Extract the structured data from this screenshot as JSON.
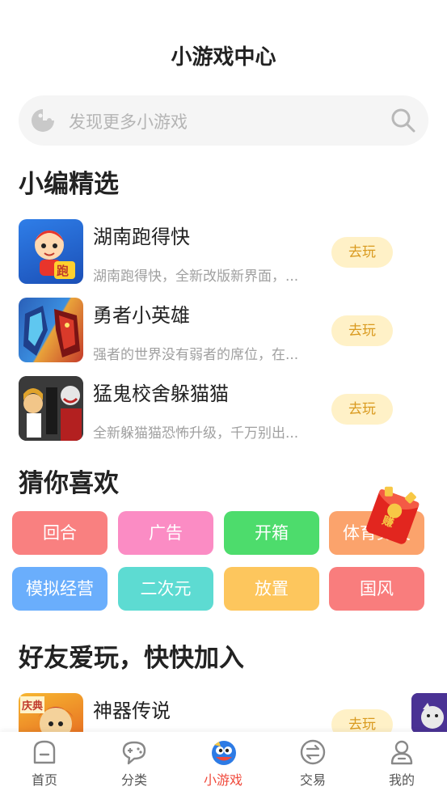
{
  "header": {
    "title": "小游戏中心"
  },
  "search": {
    "placeholder": "发现更多小游戏"
  },
  "editor_picks": {
    "title": "小编精选",
    "items": [
      {
        "name": "湖南跑得快",
        "desc": "湖南跑得快，全新改版新界面，...",
        "button": "去玩",
        "thumb_text": "跑"
      },
      {
        "name": "勇者小英雄",
        "desc": "强者的世界没有弱者的席位，在...",
        "button": "去玩"
      },
      {
        "name": "猛鬼校舍躲猫猫",
        "desc": "全新躲猫猫恐怖升级，千万别出...",
        "button": "去玩"
      }
    ]
  },
  "guess": {
    "title": "猜你喜欢",
    "tags": [
      {
        "label": "回合",
        "color": "#f98080"
      },
      {
        "label": "广告",
        "color": "#fb8cc4"
      },
      {
        "label": "开箱",
        "color": "#4ddc6c"
      },
      {
        "label": "体育竞技",
        "color": "#fba36c"
      },
      {
        "label": "模拟经营",
        "color": "#6aaefc"
      },
      {
        "label": "二次元",
        "color": "#5ddbd2"
      },
      {
        "label": "放置",
        "color": "#fdc65d"
      },
      {
        "label": "国风",
        "color": "#f97d7d"
      }
    ],
    "redpacket_text": "赚"
  },
  "friends": {
    "title": "好友爱玩，快快加入",
    "items": [
      {
        "name": "神器传说",
        "button": "去玩",
        "thumb_text": "庆典"
      }
    ]
  },
  "nav": {
    "items": [
      {
        "label": "首页",
        "icon": "home-icon"
      },
      {
        "label": "分类",
        "icon": "category-icon"
      },
      {
        "label": "小游戏",
        "icon": "minigame-icon",
        "active": true
      },
      {
        "label": "交易",
        "icon": "trade-icon"
      },
      {
        "label": "我的",
        "icon": "profile-icon"
      }
    ],
    "active_color": "#f04a3c"
  }
}
